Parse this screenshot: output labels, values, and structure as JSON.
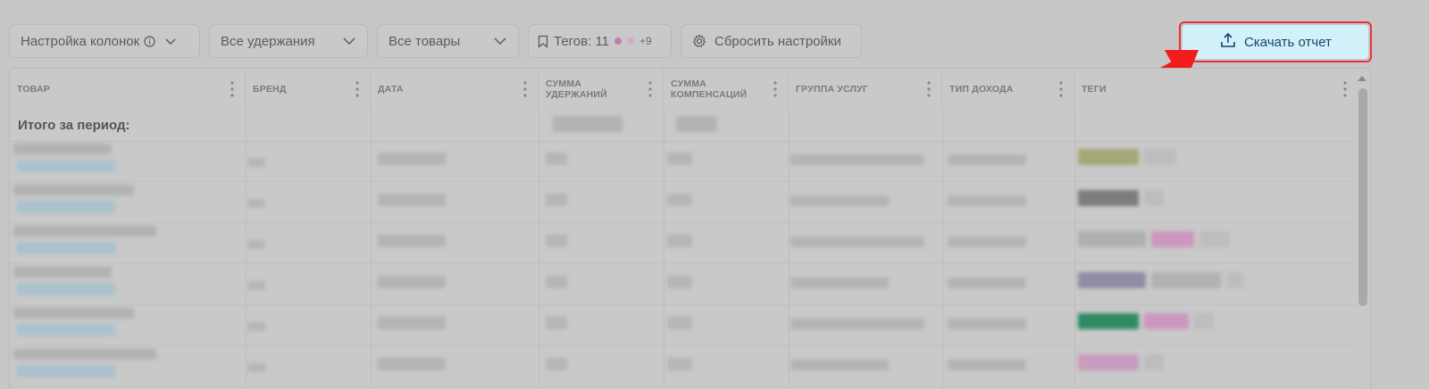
{
  "toolbar": {
    "columns_settings": "Настройка колонок",
    "deductions_filter": "Все удержания",
    "products_filter": "Все товары",
    "tags_label": "Тегов: 11",
    "tags_more": "+9",
    "reset_settings": "Сбросить настройки",
    "download_report": "Скачать отчет"
  },
  "colors": {
    "tag_dot_1": "#d468b8",
    "tag_dot_2": "#e3a3cf",
    "download_bg": "#d3f1fb",
    "highlight": "#e8313a"
  },
  "table": {
    "columns": [
      "ТОВАР",
      "БРЕНД",
      "ДАТА",
      "СУММА УДЕРЖАНИЙ",
      "СУММА КОМПЕНСАЦИЙ",
      "ГРУППА УСЛУГ",
      "ТИП ДОХОДА",
      "ТЕГИ"
    ],
    "total_label": "Итого за период:"
  }
}
